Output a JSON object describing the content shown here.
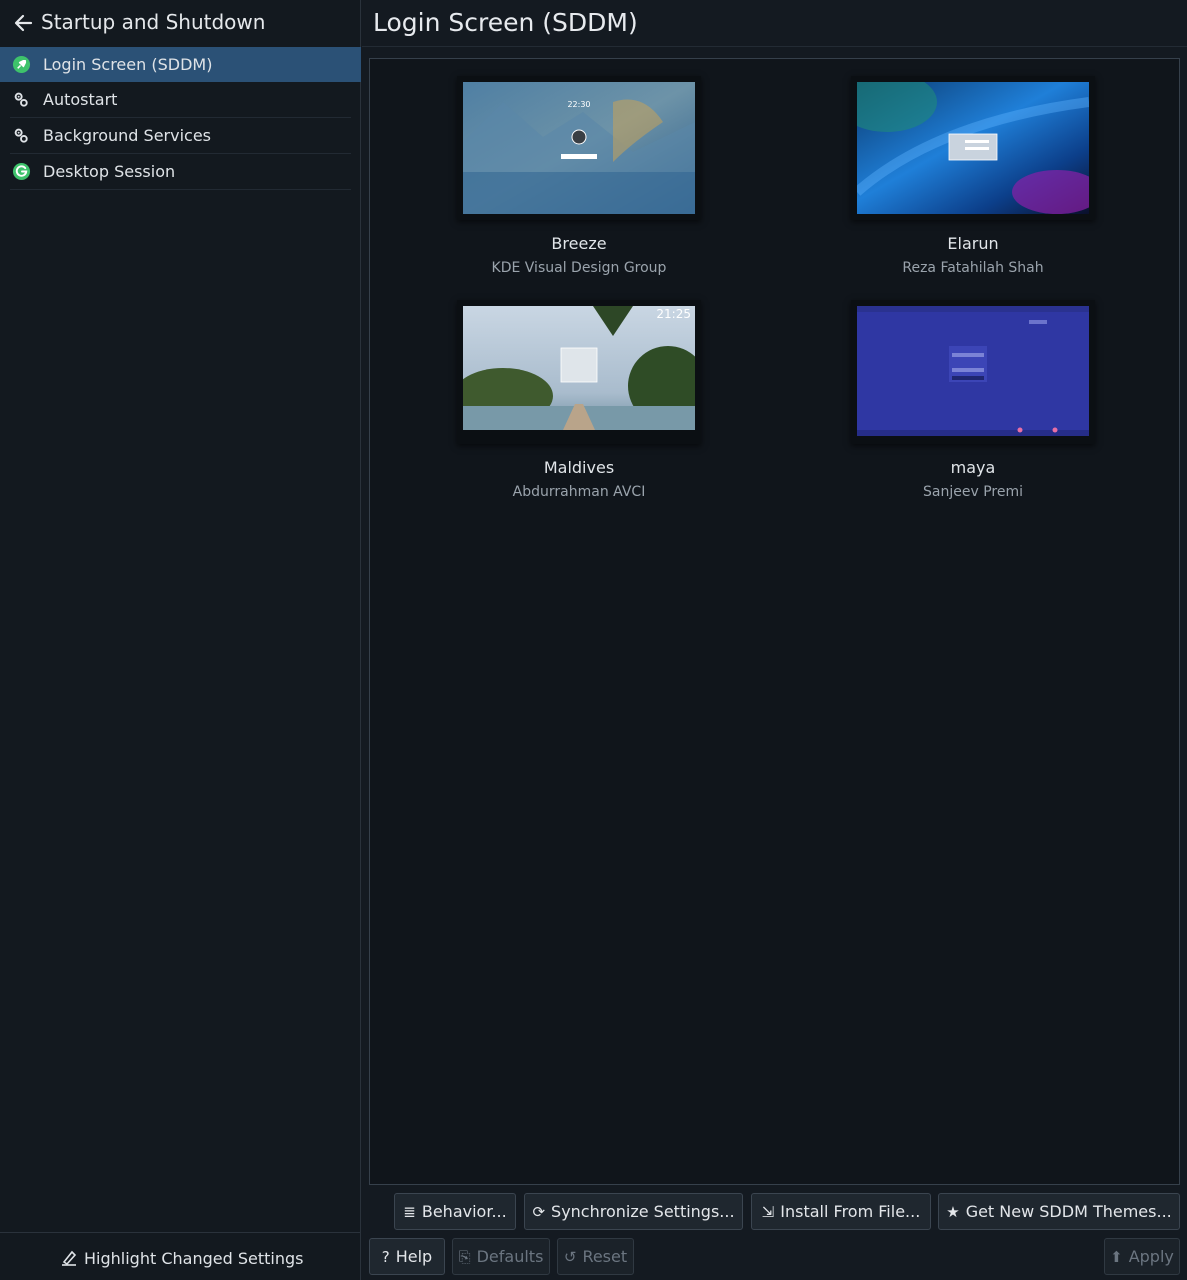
{
  "sidebar": {
    "title": "Startup and Shutdown",
    "items": [
      {
        "label": "Login Screen (SDDM)",
        "icon": "sddm-icon",
        "selected": true
      },
      {
        "label": "Autostart",
        "icon": "gears-icon",
        "selected": false
      },
      {
        "label": "Background Services",
        "icon": "gears-icon",
        "selected": false
      },
      {
        "label": "Desktop Session",
        "icon": "session-icon",
        "selected": false
      }
    ],
    "footer_button": "Highlight Changed Settings"
  },
  "main": {
    "title": "Login Screen (SDDM)",
    "themes": [
      {
        "name": "Breeze",
        "author": "KDE Visual Design Group",
        "preview_time": "22:30"
      },
      {
        "name": "Elarun",
        "author": "Reza Fatahilah Shah"
      },
      {
        "name": "Maldives",
        "author": "Abdurrahman AVCI",
        "preview_time": "21:25"
      },
      {
        "name": "maya",
        "author": "Sanjeev Premi"
      }
    ]
  },
  "toolbar": {
    "behavior": "Behavior...",
    "synchronize": "Synchronize Settings...",
    "install": "Install From File...",
    "get_new": "Get New SDDM Themes..."
  },
  "footer": {
    "help": "Help",
    "defaults": "Defaults",
    "reset": "Reset",
    "apply": "Apply"
  },
  "colors": {
    "background": "#141a21",
    "selection": "#2b5176",
    "accent_green": "#3ec26b"
  }
}
